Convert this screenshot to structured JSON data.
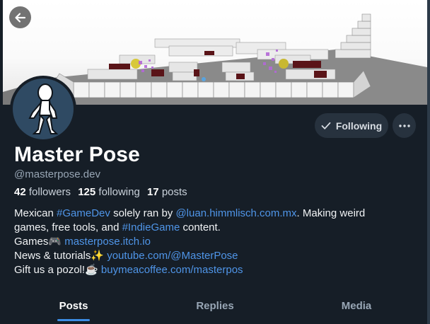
{
  "profile": {
    "display_name": "Master Pose",
    "handle": "@masterpose.dev",
    "followers_count": "42",
    "followers_label": "followers",
    "following_count": "125",
    "following_label": "following",
    "posts_count": "17",
    "posts_label": "posts"
  },
  "actions": {
    "following_label": "Following",
    "more_icon": "ellipsis-icon",
    "back_icon": "arrow-left-icon",
    "check_icon": "check-icon"
  },
  "bio": {
    "line1_prefix": "Mexican ",
    "line1_tag": "#GameDev",
    "line1_mid": " solely ran by ",
    "line1_mention": "@luan.himmlisch.com.mx",
    "line1_suffix": ". Making weird",
    "line2_prefix": "games, free tools, and ",
    "line2_tag": "#IndieGame",
    "line2_suffix": " content.",
    "line3_prefix": "Games🎮 ",
    "line3_link": "masterpose.itch.io",
    "line4_prefix": "News & tutorials✨ ",
    "line4_link": "youtube.com/@MasterPose",
    "line5_prefix": "Gift us a pozol!☕ ",
    "line5_link": "buymeacoffee.com/masterpos"
  },
  "tabs": [
    {
      "label": "Posts",
      "active": true
    },
    {
      "label": "Replies",
      "active": false
    },
    {
      "label": "Media",
      "active": false
    }
  ],
  "colors": {
    "background": "#161e27",
    "accent": "#3c8de5",
    "link": "#4f95e8",
    "button_bg": "#27323e"
  }
}
